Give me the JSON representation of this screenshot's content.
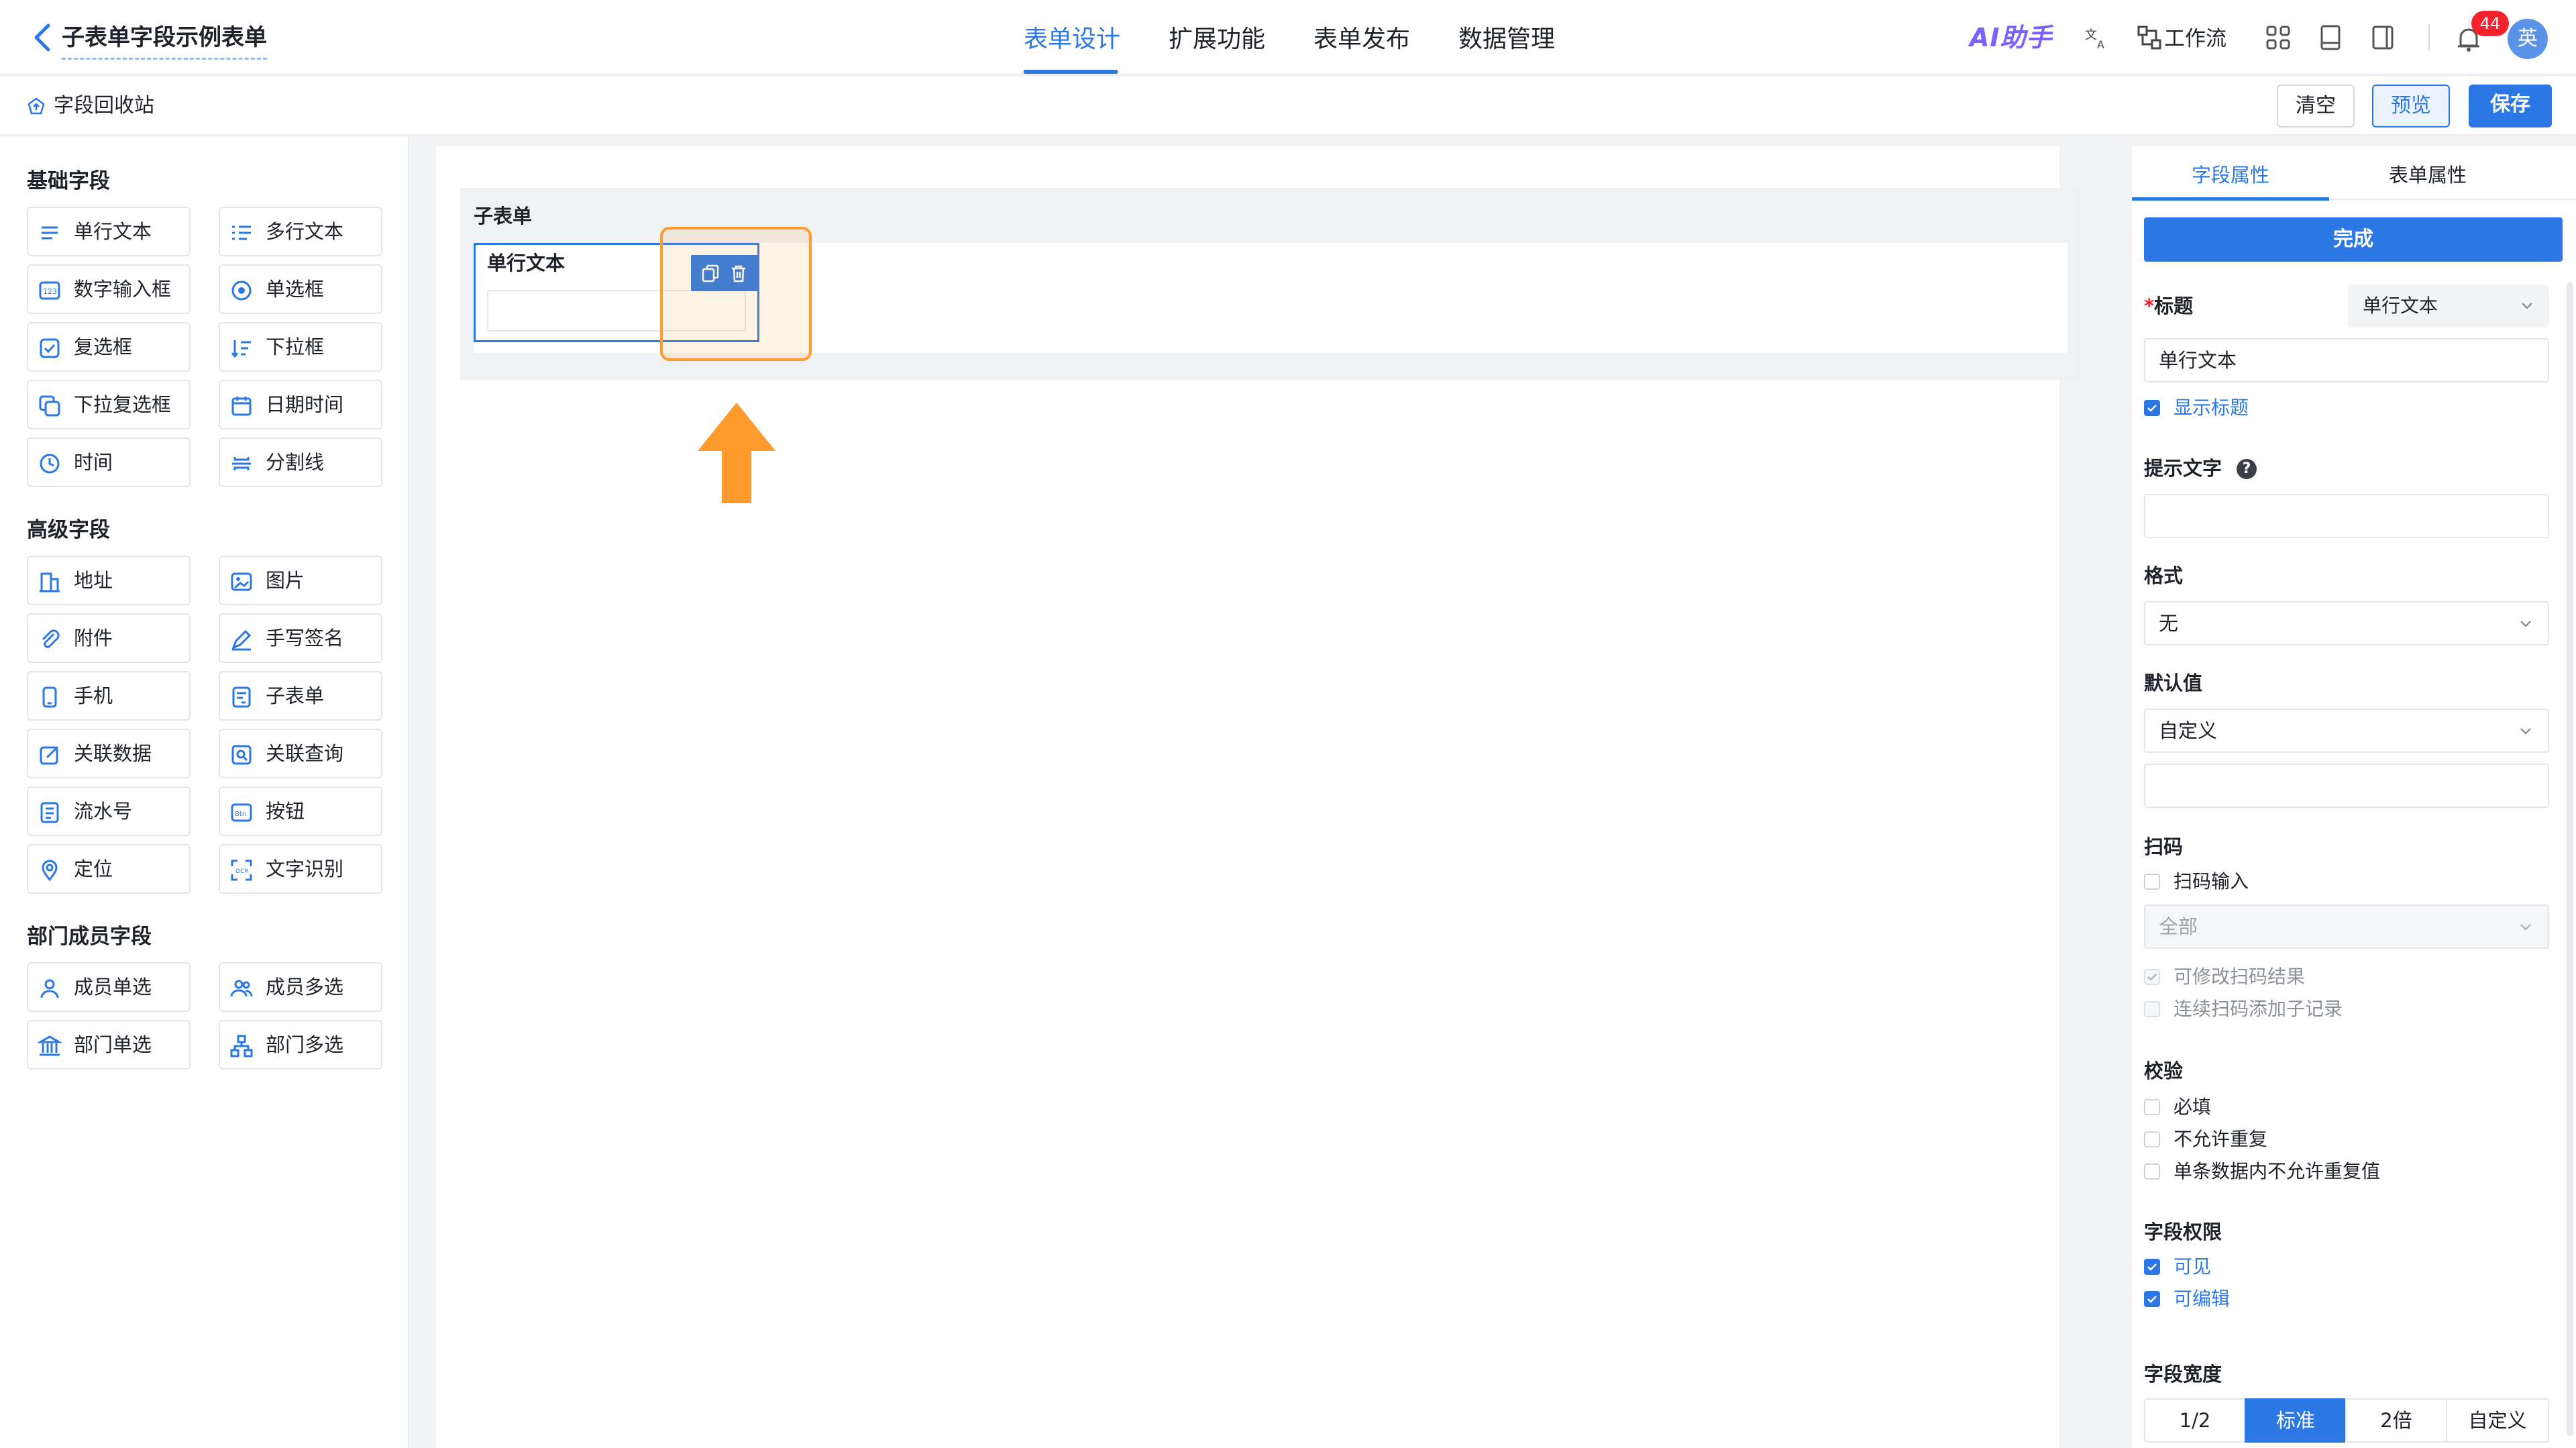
{
  "header": {
    "title": "子表单字段示例表单",
    "tabs": [
      "表单设计",
      "扩展功能",
      "表单发布",
      "数据管理"
    ],
    "active_tab": "表单设计",
    "ai_label": "AI助手",
    "workflow_label": "工作流",
    "notification_count": "44",
    "avatar_text": "英"
  },
  "toolbar": {
    "recycle_label": "字段回收站",
    "clear_label": "清空",
    "preview_label": "预览",
    "save_label": "保存"
  },
  "palette": {
    "basic_title": "基础字段",
    "basic": [
      "单行文本",
      "多行文本",
      "数字输入框",
      "单选框",
      "复选框",
      "下拉框",
      "下拉复选框",
      "日期时间",
      "时间",
      "分割线"
    ],
    "advanced_title": "高级字段",
    "advanced": [
      "地址",
      "图片",
      "附件",
      "手写签名",
      "手机",
      "子表单",
      "关联数据",
      "关联查询",
      "流水号",
      "按钮",
      "定位",
      "文字识别"
    ],
    "member_title": "部门成员字段",
    "member": [
      "成员单选",
      "成员多选",
      "部门单选",
      "部门多选"
    ]
  },
  "canvas": {
    "subform_title": "子表单",
    "field_label": "单行文本"
  },
  "props": {
    "tabs": [
      "字段属性",
      "表单属性"
    ],
    "done_label": "完成",
    "title_label": "标题",
    "title_required_mark": "*",
    "title_type": "单行文本",
    "title_value": "单行文本",
    "show_title_label": "显示标题",
    "hint_label": "提示文字",
    "hint_help": "?",
    "format_label": "格式",
    "format_value": "无",
    "default_label": "默认值",
    "default_value": "自定义",
    "scan_label": "扫码",
    "scan_input_label": "扫码输入",
    "scan_scope_value": "全部",
    "scan_editable_label": "可修改扫码结果",
    "scan_continuous_label": "连续扫码添加子记录",
    "validate_label": "校验",
    "validate_options": [
      "必填",
      "不允许重复",
      "单条数据内不允许重复值"
    ],
    "permission_label": "字段权限",
    "permission_options": [
      "可见",
      "可编辑"
    ],
    "width_label": "字段宽度",
    "width_options": [
      "1/2",
      "标准",
      "2倍",
      "自定义"
    ],
    "width_selected": "标准"
  },
  "colors": {
    "accent": "#2b78e4",
    "highlight": "#ff9a2e",
    "badge": "#f5222d"
  }
}
